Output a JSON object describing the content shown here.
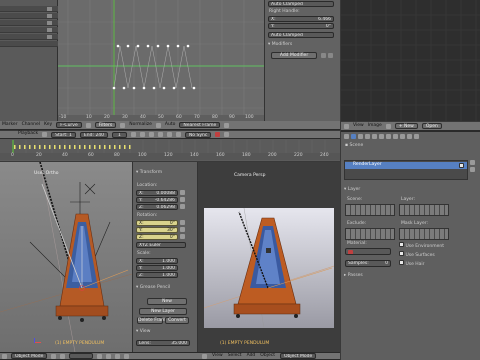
{
  "graph_sidebar": {
    "mode1": "Auto Clamped",
    "right_handle_label": "Right Handle:",
    "x_label": "X:",
    "x_value": "6.466",
    "y_label": "Y:",
    "y_value": "0°",
    "mode2": "Auto Clamped",
    "modifiers_label": "Modifiers",
    "add_modifier": "Add Modifier"
  },
  "graph_ruler": [
    "-10",
    "0",
    "10",
    "20",
    "30",
    "40",
    "50",
    "60",
    "70",
    "80",
    "90",
    "100",
    "110",
    "120"
  ],
  "graph_header": {
    "marker": "Marker",
    "channel": "Channel",
    "key": "Key",
    "curve_type": "F-Curve",
    "filters": "Filters",
    "normalize": "Normalize",
    "auto": "Auto",
    "nearest_frame": "Nearest Frame"
  },
  "timeline": {
    "playback": "Playback",
    "start": "Start:",
    "start_val": "1",
    "end": "End:",
    "end_val": "240",
    "frame_val": "1",
    "sync": "No Sync",
    "ruler": [
      "0",
      "10",
      "20",
      "30",
      "40",
      "50",
      "60",
      "70",
      "80",
      "90",
      "100",
      "110",
      "120",
      "130",
      "140",
      "150",
      "160",
      "170",
      "180",
      "190",
      "200",
      "210",
      "220",
      "230",
      "240",
      "250"
    ]
  },
  "left_view": {
    "title": "User Ortho",
    "status": "(1) EMPTY PENDULUM",
    "footer": [
      "View",
      "Select",
      "Add",
      "Object"
    ],
    "mode": "Object Mode"
  },
  "transform_panel": {
    "title": "Transform",
    "location": "Location:",
    "loc": [
      {
        "k": "X:",
        "v": "0.00088"
      },
      {
        "k": "Y:",
        "v": "-0.64286"
      },
      {
        "k": "Z:",
        "v": "0.06298"
      }
    ],
    "rotation": "Rotation:",
    "rot": [
      {
        "k": "X:",
        "v": "0°"
      },
      {
        "k": "Y:",
        "v": "30°"
      },
      {
        "k": "Z:",
        "v": "0°"
      }
    ],
    "rot_mode": "XYZ Euler",
    "scale": "Scale:",
    "scl": [
      {
        "k": "X:",
        "v": "1.000"
      },
      {
        "k": "Y:",
        "v": "1.000"
      },
      {
        "k": "Z:",
        "v": "1.000"
      }
    ],
    "grease_pencil": "Grease Pencil",
    "new": "New",
    "new_layer": "New Layer",
    "delete_frame": "Delete Frame",
    "convert": "Convert",
    "view": "View",
    "lens_label": "Lens:",
    "lens_val": "35.000"
  },
  "right_view": {
    "title": "Camera Persp",
    "status": "(1) EMPTY PENDULUM",
    "footer": [
      "View",
      "Select",
      "Add",
      "Object"
    ],
    "mode": "Object Mode"
  },
  "props": {
    "header": [
      "View",
      "Image",
      "New",
      "Open"
    ],
    "scene": "Scene",
    "render_layer": "RenderLayer",
    "layer_label": "Layer",
    "scene_label": "Scene:",
    "layer_sub": "Layer:",
    "exclude": "Exclude:",
    "mask_layer": "Mask Layer:",
    "material": "Material:",
    "samples": "Samples:",
    "samples_val": "0",
    "use_env": "Use Environment",
    "use_surfaces": "Use Surfaces",
    "use_hair": "Use Hair",
    "passes": "Passes"
  },
  "colors": {
    "accent": "#5680c2",
    "selected_field": "#d9d38c",
    "curve_green": "#5ddc5d",
    "frame_marker": "#5ccc3a",
    "bg": "#393939"
  }
}
